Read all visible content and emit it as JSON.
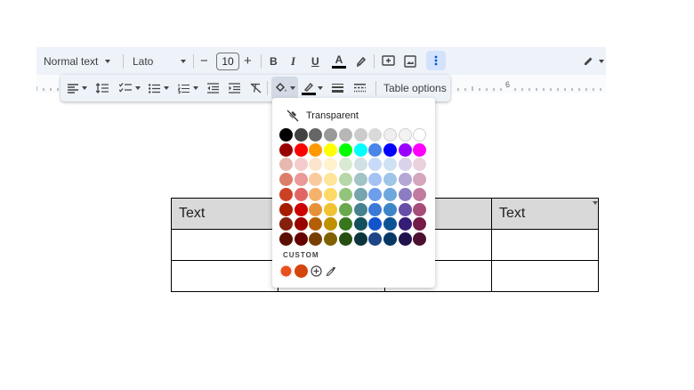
{
  "toolbar": {
    "style_label": "Normal text",
    "font_label": "Lato",
    "font_size": "10",
    "bold_label": "B",
    "italic_label": "I",
    "underline_label": "U",
    "text_color_label": "A",
    "text_color_bar": "#000000"
  },
  "table_toolbar": {
    "table_options_label": "Table options",
    "border_color_bar": "#000000"
  },
  "ruler": {
    "marker_label": "6"
  },
  "table": {
    "rows": [
      [
        "Text",
        "",
        "",
        "Text"
      ],
      [
        "",
        "",
        "",
        ""
      ],
      [
        "",
        "",
        "",
        ""
      ]
    ]
  },
  "palette": {
    "transparent_label": "Transparent",
    "custom_label": "CUSTOM",
    "rows": [
      [
        "#000000",
        "#434343",
        "#666666",
        "#999999",
        "#b7b7b7",
        "#cccccc",
        "#d9d9d9",
        "#efefef",
        "#f3f3f3",
        "#ffffff"
      ],
      [
        "#980000",
        "#ff0000",
        "#ff9900",
        "#ffff00",
        "#00ff00",
        "#00ffff",
        "#4a86e8",
        "#0000ff",
        "#9900ff",
        "#ff00ff"
      ],
      [
        "#e6b8af",
        "#f4cccc",
        "#fce5cd",
        "#fff2cc",
        "#d9ead3",
        "#d0e0e3",
        "#c9daf8",
        "#cfe2f3",
        "#d9d2e9",
        "#ead1dc"
      ],
      [
        "#dd7e6b",
        "#ea9999",
        "#f9cb9c",
        "#ffe599",
        "#b6d7a8",
        "#a2c4c9",
        "#a4c2f4",
        "#9fc5e8",
        "#b4a7d6",
        "#d5a6bd"
      ],
      [
        "#cc4125",
        "#e06666",
        "#f6b26b",
        "#ffd966",
        "#93c47d",
        "#76a5af",
        "#6d9eeb",
        "#6fa8dc",
        "#8e7cc3",
        "#c27ba0"
      ],
      [
        "#a61c00",
        "#cc0000",
        "#e69138",
        "#f1c232",
        "#6aa84f",
        "#45818e",
        "#3c78d8",
        "#3d85c6",
        "#674ea7",
        "#a64d79"
      ],
      [
        "#85200c",
        "#990000",
        "#b45f06",
        "#bf9000",
        "#38761d",
        "#134f5c",
        "#1155cc",
        "#0b5394",
        "#351c75",
        "#741b47"
      ],
      [
        "#5b0f00",
        "#660000",
        "#783f04",
        "#7f6000",
        "#274e13",
        "#0c343d",
        "#1c4587",
        "#073763",
        "#20124d",
        "#4c1130"
      ]
    ],
    "custom_colors": [
      "#e8511f",
      "#d4450c"
    ]
  }
}
